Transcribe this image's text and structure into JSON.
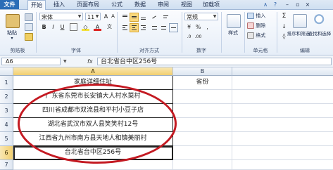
{
  "ribbon": {
    "tabs": [
      "文件",
      "开始",
      "插入",
      "页面布局",
      "公式",
      "数据",
      "审阅",
      "视图",
      "加载项"
    ],
    "active_tab": "开始",
    "clipboard": {
      "paste_label": "粘贴",
      "group_label": "剪贴板"
    },
    "font": {
      "name": "宋体",
      "size": "11",
      "group_label": "字体"
    },
    "alignment": {
      "group_label": "对齐方式"
    },
    "number": {
      "format": "常规",
      "group_label": "数字"
    },
    "styles": {
      "label": "样式"
    },
    "cells": {
      "insert": "插入",
      "delete": "删除",
      "format": "格式",
      "group_label": "单元格"
    },
    "editing": {
      "sort_filter": "排序和筛选",
      "find_select": "查找和选择",
      "group_label": "编辑"
    }
  },
  "formula_bar": {
    "name_box": "A6",
    "fx": "fx",
    "content": "台北省台中区256号"
  },
  "sheet": {
    "columns": [
      "A",
      "B"
    ],
    "selected_column": "A",
    "rows": [
      {
        "num": "1",
        "a": "家庭详细住址",
        "b": "省份"
      },
      {
        "num": "2",
        "a": "广东省东莞市长安镇大人村水菜村",
        "b": ""
      },
      {
        "num": "3",
        "a": "四川省成都市双流县和平村小豆子店",
        "b": ""
      },
      {
        "num": "4",
        "a": "湖北省武汉市双人县笑笑村12号",
        "b": ""
      },
      {
        "num": "5",
        "a": "江西省九州市南方县天地人和镇美丽村",
        "b": ""
      },
      {
        "num": "6",
        "a": "台北省台中区256号",
        "b": ""
      },
      {
        "num": "7",
        "a": "",
        "b": ""
      }
    ],
    "selected_row": "6"
  },
  "colors": {
    "annotation_oval": "#c41a22",
    "selection_header": "#f2cf6f",
    "file_tab": "#2b6db7"
  }
}
